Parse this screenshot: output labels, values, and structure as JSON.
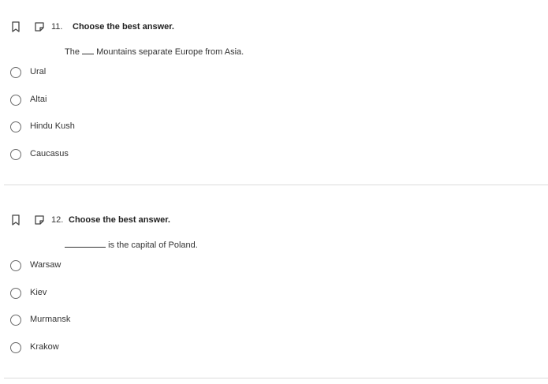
{
  "questions": [
    {
      "number": "11.",
      "title": "Choose the best answer.",
      "prompt_before": "The",
      "prompt_after": "Mountains separate Europe from Asia.",
      "options": [
        "Ural",
        "Altai",
        "Hindu Kush",
        "Caucasus"
      ]
    },
    {
      "number": "12.",
      "title": "Choose the best answer.",
      "prompt_before": "",
      "prompt_after": "is the capital of Poland.",
      "options": [
        "Warsaw",
        "Kiev",
        "Murmansk",
        "Krakow"
      ]
    }
  ],
  "icons": {
    "bookmark": "bookmark-icon",
    "note": "note-icon"
  },
  "colors": {
    "text": "#212121",
    "radio_border": "#6b6b6b",
    "divider": "#dcdcdc"
  }
}
